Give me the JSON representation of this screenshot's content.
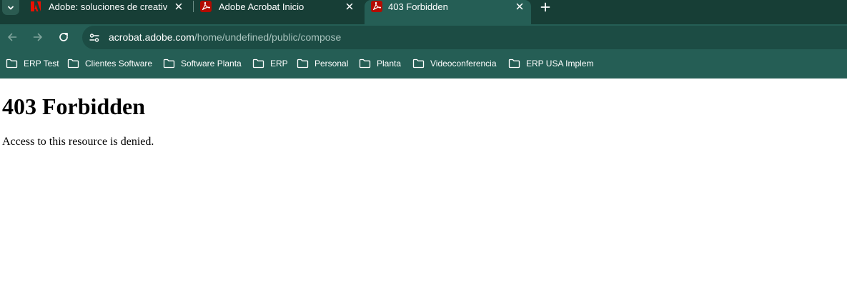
{
  "browser": {
    "tabs": [
      {
        "title": "Adobe: soluciones de creatividad",
        "favicon": "adobe-logo-icon",
        "active": false
      },
      {
        "title": "Adobe Acrobat Inicio",
        "favicon": "acrobat-pdf-icon",
        "active": false
      },
      {
        "title": "403 Forbidden",
        "favicon": "acrobat-pdf-icon",
        "active": true
      }
    ],
    "url_host": "acrobat.adobe.com",
    "url_path": "/home/undefined/public/compose",
    "bookmarks": [
      {
        "label": "ERP Test",
        "icon": "folder-icon"
      },
      {
        "label": "Clientes Software",
        "icon": "folder-icon"
      },
      {
        "label": "Software Planta",
        "icon": "folder-icon"
      },
      {
        "label": "ERP",
        "icon": "folder-icon"
      },
      {
        "label": "Personal",
        "icon": "folder-icon"
      },
      {
        "label": "Planta",
        "icon": "folder-icon"
      },
      {
        "label": "Videoconferencia",
        "icon": "folder-icon"
      },
      {
        "label": "ERP USA Implem",
        "icon": "folder-icon"
      }
    ],
    "colors": {
      "tabstrip": "#173e36",
      "toolbar": "#255e55",
      "omnibox": "#1c4c44",
      "adobe_red": "#eb1000",
      "acrobat_red": "#b30b00"
    }
  },
  "page": {
    "heading": "403 Forbidden",
    "message": "Access to this resource is denied."
  }
}
